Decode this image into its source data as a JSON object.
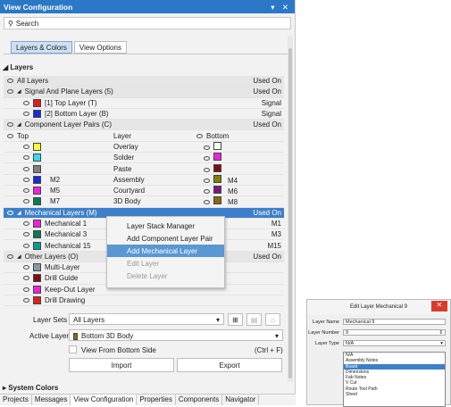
{
  "title": "View Configuration",
  "title_ctl": "▾ ✕",
  "search": "Search",
  "tabs": [
    "Layers & Colors",
    "View Options"
  ],
  "layers_header": "Layers",
  "all_layers": {
    "label": "All Layers",
    "used": "Used On"
  },
  "signal": {
    "label": "Signal And Plane Layers (5)",
    "used": "Used On",
    "rows": [
      {
        "label": "[1] Top Layer (T)",
        "color": "#e51c1c",
        "right": "Signal"
      },
      {
        "label": "[2] Bottom Layer (B)",
        "color": "#1a2bd6",
        "right": "Signal"
      }
    ]
  },
  "pairs": {
    "label": "Component Layer Pairs (C)",
    "used": "Used On",
    "col_top": "Top",
    "col_layer": "Layer",
    "col_bottom": "Bottom",
    "rows": [
      {
        "top": "",
        "tc": "#ffff33",
        "layer": "Overlay",
        "bc": "#ffffff",
        "bottom": ""
      },
      {
        "top": "",
        "tc": "#33ddee",
        "layer": "Solder",
        "bc": "#ee22dd",
        "bottom": ""
      },
      {
        "top": "",
        "tc": "#808080",
        "layer": "Paste",
        "bc": "#801010",
        "bottom": ""
      },
      {
        "top": "M2",
        "tc": "#1a2bd6",
        "layer": "Assembly",
        "bc": "#808000",
        "bottom": "M4"
      },
      {
        "top": "M5",
        "tc": "#ee22dd",
        "layer": "Courtyard",
        "bc": "#7a1a80",
        "bottom": "M6"
      },
      {
        "top": "M7",
        "tc": "#0a7a55",
        "layer": "3D Body",
        "bc": "#8a6a10",
        "bottom": "M8"
      }
    ]
  },
  "mech": {
    "label": "Mechanical Layers (M)",
    "used": "Used On",
    "rows": [
      {
        "label": "Mechanical 1",
        "color": "#ee22dd",
        "right": "M1"
      },
      {
        "label": "Mechanical 3",
        "color": "#0a7a55",
        "right": "M3"
      },
      {
        "label": "Mechanical 15",
        "color": "#0a9a90",
        "right": "M15"
      }
    ]
  },
  "other": {
    "label": "Other Layers (O)",
    "used": "Used On",
    "rows": [
      {
        "label": "Multi-Layer",
        "color": "#8899aa"
      },
      {
        "label": "Drill Guide",
        "color": "#801010"
      },
      {
        "label": "Keep-Out Layer",
        "color": "#ee22dd"
      },
      {
        "label": "Drill Drawing",
        "color": "#e51c1c"
      }
    ]
  },
  "context_menu": [
    "Layer Stack Manager",
    "Add Component Layer Pair",
    "Add Mechanical Layer",
    "Edit Layer",
    "Delete Layer"
  ],
  "layer_sets_label": "Layer Sets",
  "layer_sets_value": "All Layers",
  "active_layer_label": "Active Layer",
  "active_layer_value": "Bottom 3D Body",
  "active_layer_color": "#8a6a10",
  "view_bottom": "View From Bottom Side",
  "view_bottom_key": "(Ctrl + F)",
  "import": "Import",
  "export": "Export",
  "system_colors": "System Colors",
  "bottom_tabs": [
    "Projects",
    "Messages",
    "View Configuration",
    "Properties",
    "Components",
    "Navigator"
  ],
  "dialog": {
    "title": "Edit Layer Mechanical 9",
    "name_label": "Layer Name",
    "name": "Mechanical 9",
    "number_label": "Layer Number",
    "number": "9",
    "type_label": "Layer Type",
    "type": "N/A",
    "options": [
      "N/A",
      "Assembly Notes",
      "Board",
      "Dimensions",
      "Fab Notes",
      "V Cut",
      "Route Tool Path",
      "Sheet"
    ]
  }
}
